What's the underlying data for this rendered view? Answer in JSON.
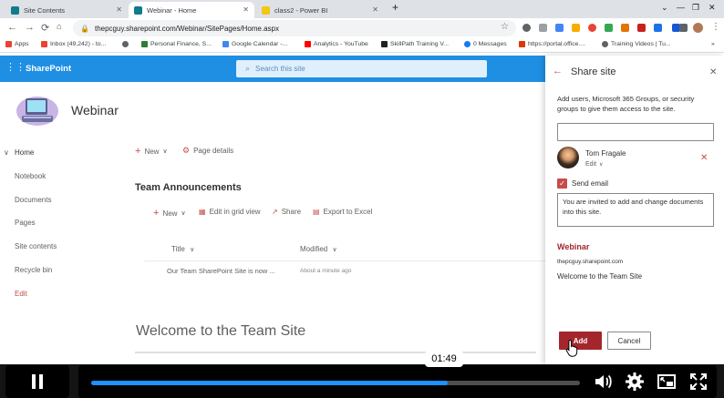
{
  "browser": {
    "tabs": [
      {
        "title": "Site Contents",
        "icon_color": "#0f7b8c",
        "close": "✕"
      },
      {
        "title": "Webinar - Home",
        "icon_color": "#0f7b8c",
        "close": "✕"
      },
      {
        "title": "class2 - Power BI",
        "icon_color": "#f2c811",
        "close": "✕"
      }
    ],
    "new_tab": "+",
    "window_controls": [
      "⌄",
      "—",
      "❐",
      "✕"
    ],
    "url": "thepcguy.sharepoint.com/Webinar/SitePages/Home.aspx",
    "bookmarks": [
      {
        "label": "Apps",
        "color": "#ea4335"
      },
      {
        "label": "Inbox (49,242) - to...",
        "color": "#ea4335"
      },
      {
        "label": "",
        "color": "#5f6368"
      },
      {
        "label": "Personal Finance, S...",
        "color": "#2e7d32"
      },
      {
        "label": "Google Calendar -...",
        "color": "#4285f4"
      },
      {
        "label": "Analytics - YouTube",
        "color": "#ff0000"
      },
      {
        "label": "SkillPath Training V...",
        "color": "#202124"
      },
      {
        "label": "0 Messages",
        "color": "#1877f2"
      },
      {
        "label": "https://portal.office....",
        "color": "#d83b01"
      },
      {
        "label": "Training Videos | Tu...",
        "color": "#5f6368"
      }
    ],
    "bookmarks_more": "»"
  },
  "suite": {
    "app_name": "SharePoint",
    "search_placeholder": "Search this site"
  },
  "site": {
    "title": "Webinar",
    "left_nav": [
      {
        "label": "Home",
        "current": true
      },
      {
        "label": "Notebook"
      },
      {
        "label": "Documents"
      },
      {
        "label": "Pages"
      },
      {
        "label": "Site contents"
      },
      {
        "label": "Recycle bin"
      },
      {
        "label": "Edit",
        "accent": true
      }
    ],
    "commands": {
      "new": "New",
      "page_details": "Page details"
    },
    "section_title": "Team Announcements",
    "list_commands": {
      "new": "New",
      "grid": "Edit in grid view",
      "share": "Share",
      "export": "Export to Excel"
    },
    "columns": {
      "title": "Title",
      "modified": "Modified"
    },
    "rows": [
      {
        "title": "Our Team SharePoint Site is now ...",
        "modified": "About a minute ago"
      }
    ],
    "welcome_title": "Welcome to the Team Site"
  },
  "share_panel": {
    "title": "Share site",
    "description": "Add users, Microsoft 365 Groups, or security groups to give them access to the site.",
    "user_name": "Tom Fragale",
    "permission": "Edit",
    "send_email_label": "Send email",
    "message": "You are invited to add and change documents into this site.",
    "card_title": "Webinar",
    "card_url": "thepcguy.sharepoint.com",
    "card_desc": "Welcome to the Team Site",
    "add_label": "Add",
    "cancel_label": "Cancel"
  },
  "video": {
    "time": "01:49",
    "progress_fraction": 0.73
  },
  "colors": {
    "suite_blue": "#1f8fe3",
    "accent_red": "#a4262c",
    "progress_blue": "#1e90ff"
  }
}
